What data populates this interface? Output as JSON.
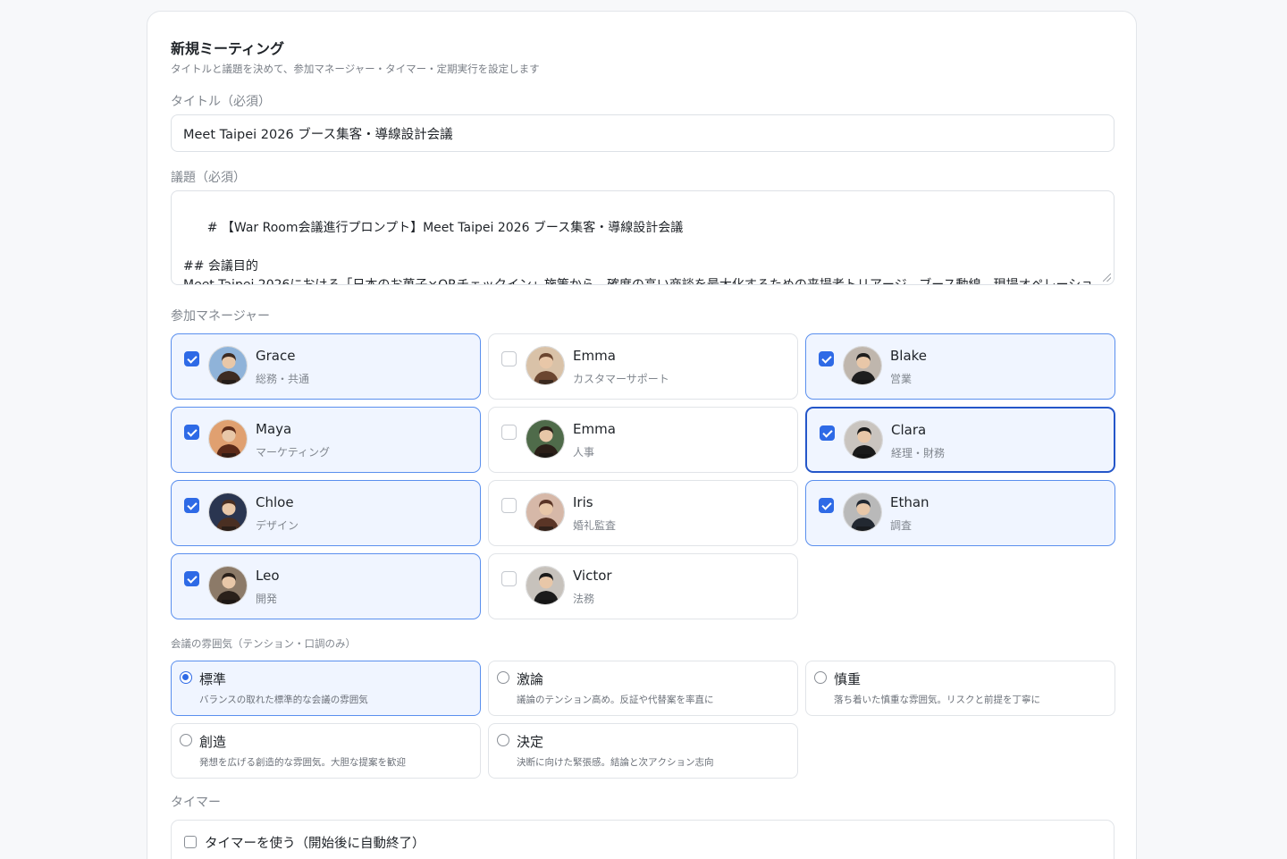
{
  "form": {
    "title": "新規ミーティング",
    "subtitle": "タイトルと議題を決めて、参加マネージャー・タイマー・定期実行を設定します"
  },
  "title_field": {
    "label": "タイトル（必須）",
    "value": "Meet Taipei 2026 ブース集客・導線設計会議"
  },
  "agenda_field": {
    "label": "議題（必須）",
    "value": "# 【War Room会議進行プロンプト】Meet Taipei 2026 ブース集客・導線設計会議\n\n## 会議目的\nMeet Taipei 2026における「日本のお菓子×QRチェックイン」施策から、確度の高い商談を最大化するための来場者トリアージ、ブース動線、現場オペレーションを確定する。"
  },
  "managers": {
    "label": "参加マネージャー",
    "items": [
      {
        "name": "Grace",
        "role": "総務・共通",
        "checked": true,
        "avatar_bg": "#8fb3d9",
        "avatar_fg": "#3d2b22"
      },
      {
        "name": "Emma",
        "role": "カスタマーサポート",
        "checked": false,
        "avatar_bg": "#d9c2a8",
        "avatar_fg": "#6b4630"
      },
      {
        "name": "Blake",
        "role": "営業",
        "checked": true,
        "avatar_bg": "#bfb6ad",
        "avatar_fg": "#1e1e1e"
      },
      {
        "name": "Maya",
        "role": "マーケティング",
        "checked": true,
        "avatar_bg": "#e0a070",
        "avatar_fg": "#5c2a18"
      },
      {
        "name": "Emma",
        "role": "人事",
        "checked": false,
        "avatar_bg": "#4f6b4a",
        "avatar_fg": "#2b1f18"
      },
      {
        "name": "Clara",
        "role": "経理・財務",
        "checked": true,
        "avatar_bg": "#c9c4bf",
        "avatar_fg": "#1a1a1a"
      },
      {
        "name": "Chloe",
        "role": "デザイン",
        "checked": true,
        "avatar_bg": "#2a3550",
        "avatar_fg": "#4a2f22"
      },
      {
        "name": "Iris",
        "role": "婚礼監査",
        "checked": false,
        "avatar_bg": "#d6b8a8",
        "avatar_fg": "#5a3526"
      },
      {
        "name": "Ethan",
        "role": "調査",
        "checked": true,
        "avatar_bg": "#b9b9b9",
        "avatar_fg": "#222831"
      },
      {
        "name": "Leo",
        "role": "開発",
        "checked": true,
        "avatar_bg": "#8c7a68",
        "avatar_fg": "#2a201a"
      },
      {
        "name": "Victor",
        "role": "法務",
        "checked": false,
        "avatar_bg": "#c7c2bc",
        "avatar_fg": "#1b1b1b"
      }
    ]
  },
  "mood": {
    "label": "会議の雰囲気（テンション・口調のみ）",
    "options": [
      {
        "name": "標準",
        "desc": "バランスの取れた標準的な会議の雰囲気",
        "selected": true
      },
      {
        "name": "激論",
        "desc": "議論のテンション高め。反証や代替案を率直に",
        "selected": false
      },
      {
        "name": "慎重",
        "desc": "落ち着いた慎重な雰囲気。リスクと前提を丁寧に",
        "selected": false
      },
      {
        "name": "創造",
        "desc": "発想を広げる創造的な雰囲気。大胆な提案を歓迎",
        "selected": false
      },
      {
        "name": "決定",
        "desc": "決断に向けた緊張感。結論と次アクション志向",
        "selected": false
      }
    ]
  },
  "timer": {
    "label": "タイマー",
    "checkbox_label": "タイマーを使う（開始後に自動終了）",
    "checked": false
  }
}
